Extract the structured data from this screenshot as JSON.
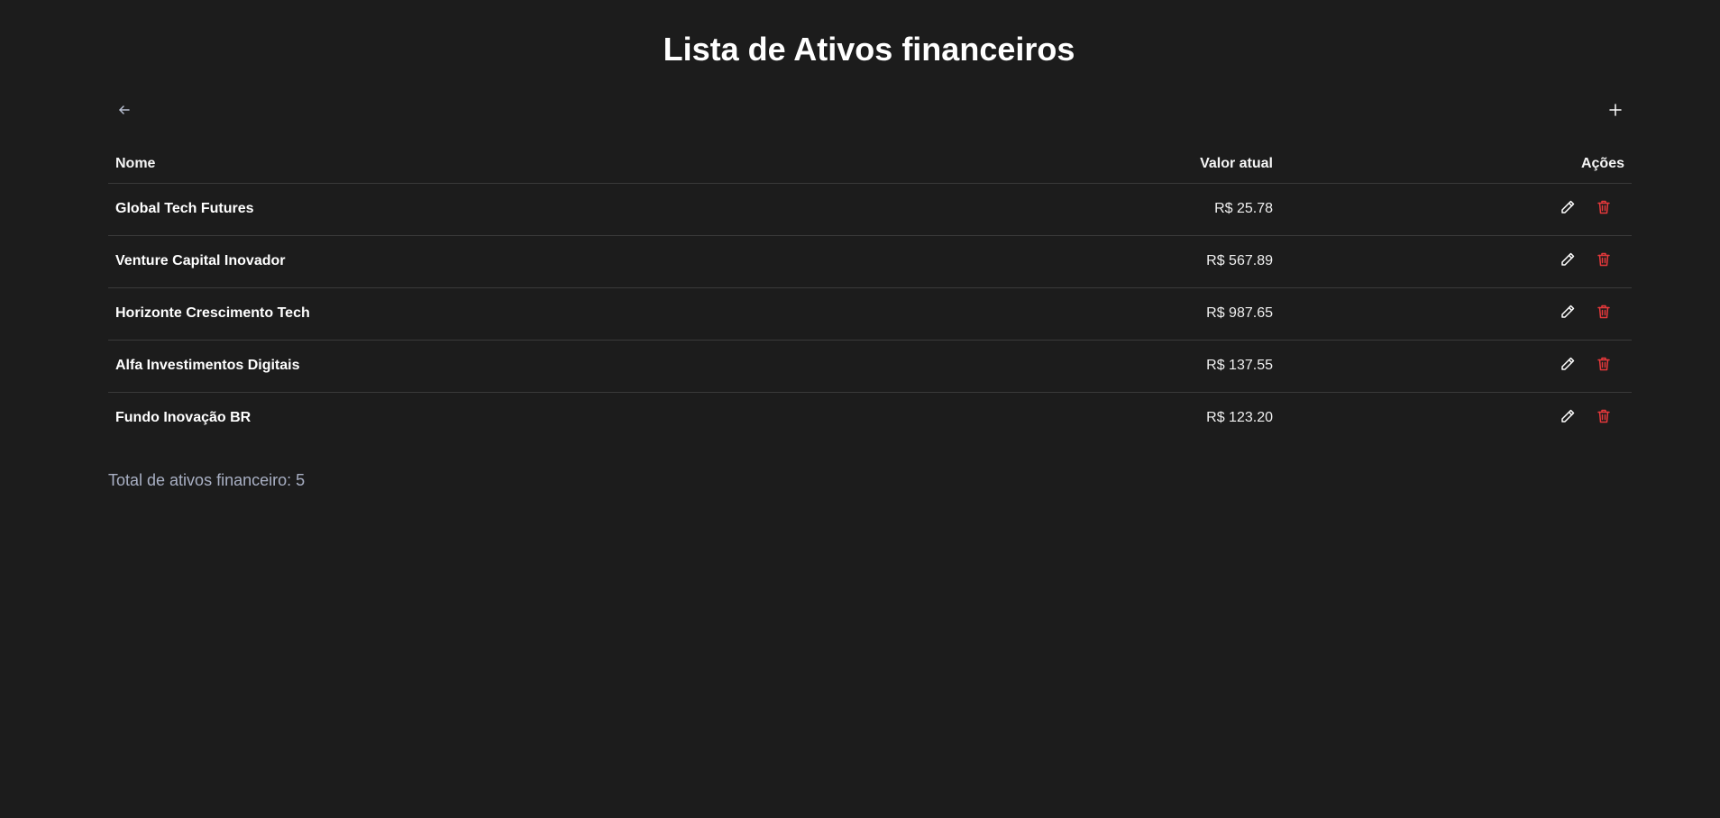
{
  "header": {
    "title": "Lista de Ativos financeiros"
  },
  "toolbar": {
    "back_icon": "arrow-left-icon",
    "add_icon": "plus-icon"
  },
  "table": {
    "columns": {
      "name": "Nome",
      "value": "Valor atual",
      "actions": "Ações"
    },
    "rows": [
      {
        "name": "Global Tech Futures",
        "value": "R$ 25.78"
      },
      {
        "name": "Venture Capital Inovador",
        "value": "R$ 567.89"
      },
      {
        "name": "Horizonte Crescimento Tech",
        "value": "R$ 987.65"
      },
      {
        "name": "Alfa Investimentos Digitais",
        "value": "R$ 137.55"
      },
      {
        "name": "Fundo Inovação BR",
        "value": "R$ 123.20"
      }
    ],
    "row_actions": {
      "edit_icon": "pencil-icon",
      "delete_icon": "trash-icon"
    }
  },
  "footer": {
    "total_text": "Total de ativos financeiro: 5"
  },
  "colors": {
    "background": "#1c1c1c",
    "text": "#ffffff",
    "muted_text": "#a9b0c4",
    "delete_accent": "#e5383b",
    "divider": "#3a3a3a"
  }
}
